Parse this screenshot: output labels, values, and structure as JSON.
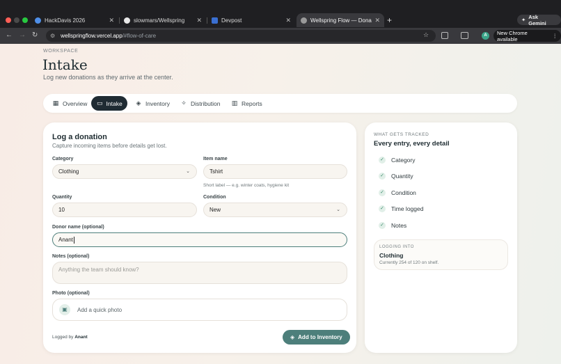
{
  "browser": {
    "tabs": [
      {
        "label": "HackDavis 2026",
        "favicon_color": "#4f8fe8"
      },
      {
        "label": "slowmars/Wellspring",
        "favicon_color": "#e8e8e8"
      },
      {
        "label": "Devpost",
        "favicon_color": "#3a6fd1"
      },
      {
        "label": "Wellspring Flow — Donations",
        "favicon_color": "#9a9a9a"
      }
    ],
    "ask_gemini": "Ask Gemini",
    "url_host": "wellspringflow.vercel.app",
    "url_path": "/#flow-of-care",
    "update_label": "New Chrome available",
    "profile_initial": "A"
  },
  "header": {
    "eyebrow": "WORKSPACE",
    "title": "Intake",
    "subtitle": "Log new donations as they arrive at the center."
  },
  "nav": {
    "tabs": [
      {
        "label": "Overview",
        "icon": "grid-icon"
      },
      {
        "label": "Intake",
        "icon": "inbox-icon"
      },
      {
        "label": "Inventory",
        "icon": "box-icon"
      },
      {
        "label": "Distribution",
        "icon": "handshake-icon"
      },
      {
        "label": "Reports",
        "icon": "bar-chart-icon"
      }
    ],
    "active": "Intake"
  },
  "form": {
    "title": "Log a donation",
    "subtitle": "Capture incoming items before details get lost.",
    "category_label": "Category",
    "category_value": "Clothing",
    "item_label": "Item name",
    "item_value": "Tshirt",
    "item_hint": "Short label — e.g. winter coats, hygiene kit",
    "quantity_label": "Quantity",
    "quantity_value": "10",
    "condition_label": "Condition",
    "condition_value": "New",
    "donor_label": "Donor name (optional)",
    "donor_value": "Anant",
    "notes_label": "Notes (optional)",
    "notes_placeholder": "Anything the team should know?",
    "photo_label": "Photo (optional)",
    "photo_button": "Add a quick photo",
    "logged_by_prefix": "Logged by",
    "logged_by_name": "Anant",
    "submit_label": "Add to Inventory"
  },
  "side": {
    "eyebrow": "WHAT GETS TRACKED",
    "title": "Every entry, every detail",
    "items": [
      "Category",
      "Quantity",
      "Condition",
      "Time logged",
      "Notes"
    ],
    "logging_eyebrow": "LOGGING INTO",
    "logging_value": "Clothing",
    "logging_status": "Currently 254 of 120 on shelf."
  }
}
